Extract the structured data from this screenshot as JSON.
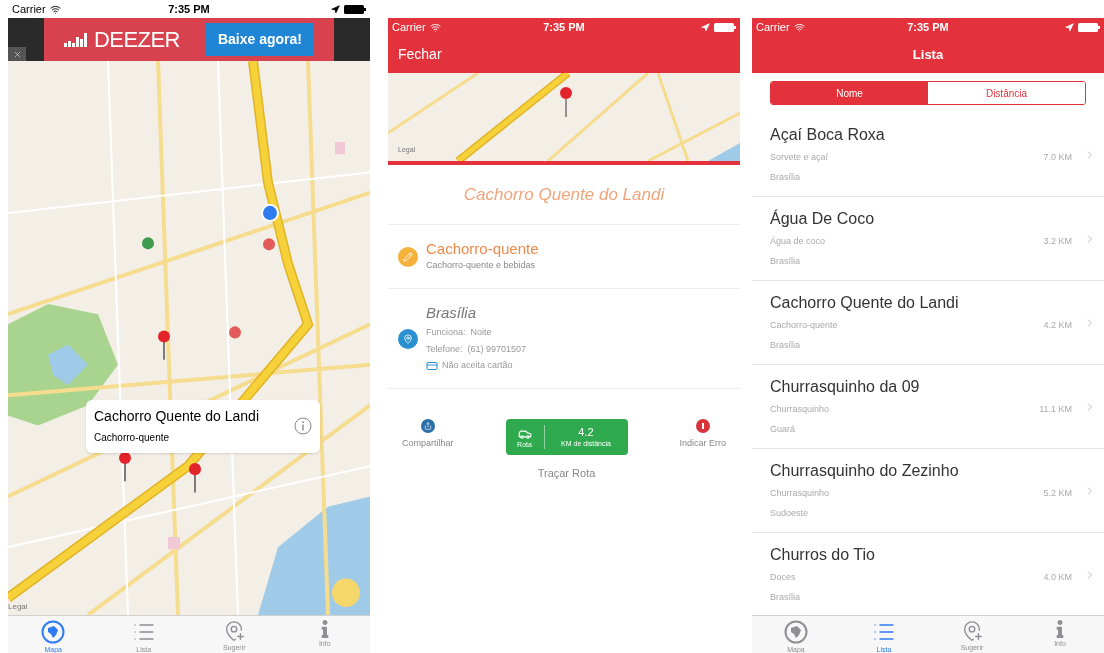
{
  "map_screen": {
    "status_bar": {
      "carrier": "Carrier",
      "time": "7:35 PM"
    },
    "ad": {
      "logo": "DEEZER",
      "button": "Baixe agora!"
    },
    "callout": {
      "title": "Cachorro Quente do Landi",
      "subtitle": "Cachorro-quente"
    },
    "legal": "Legal",
    "tab_bar": [
      {
        "label": "Mapa",
        "selected": true
      },
      {
        "label": "Lista",
        "selected": false
      },
      {
        "label": "Sugerir",
        "selected": false
      },
      {
        "label": "Info",
        "selected": false
      }
    ]
  },
  "detail_screen": {
    "status_bar": {
      "carrier": "Carrier",
      "time": "7:35 PM"
    },
    "close_button": "Fechar",
    "legal": "Legal",
    "title": "Cachorro Quente do Landi",
    "category": {
      "title": "Cachorro-quente",
      "subtitle": "Cachorro-quente e bebidas"
    },
    "location": {
      "city": "Brasília",
      "hours": "Funciona:  Noite",
      "phone": "Telefone:  (61) 99701507",
      "card": "Não aceita cartão"
    },
    "share": "Compartilhar",
    "route": {
      "caption": "Rota",
      "distance": "4.2",
      "unit": "KM de distância"
    },
    "report": "Indicar Erro",
    "route_label": "Traçar Rota"
  },
  "list_screen": {
    "status_bar": {
      "carrier": "Carrier",
      "time": "7:35 PM"
    },
    "title": "Lista",
    "segments": [
      {
        "label": "Nome",
        "selected": true
      },
      {
        "label": "Distância",
        "selected": false
      }
    ],
    "items": [
      {
        "name": "Açaí Boca Roxa",
        "category": "Sorvete e açaí",
        "distance": "7.0 KM",
        "city": "Brasília"
      },
      {
        "name": "Água De Coco",
        "category": "Água de coco",
        "distance": "3.2 KM",
        "city": "Brasília"
      },
      {
        "name": "Cachorro Quente do Landi",
        "category": "Cachorro-quente",
        "distance": "4.2 KM",
        "city": "Brasília"
      },
      {
        "name": "Churrasquinho da 09",
        "category": "Churrasquinho",
        "distance": "11.1 KM",
        "city": "Guará"
      },
      {
        "name": "Churrasquinho do Zezinho",
        "category": "Churrasquinho",
        "distance": "5.2 KM",
        "city": "Sudoeste"
      },
      {
        "name": "Churros do Tio",
        "category": "Doces",
        "distance": "4.0 KM",
        "city": "Brasília"
      }
    ],
    "tab_bar": [
      {
        "label": "Mapa",
        "selected": false
      },
      {
        "label": "Lista",
        "selected": true
      },
      {
        "label": "Sugerir",
        "selected": false
      },
      {
        "label": "Info",
        "selected": false
      }
    ]
  }
}
